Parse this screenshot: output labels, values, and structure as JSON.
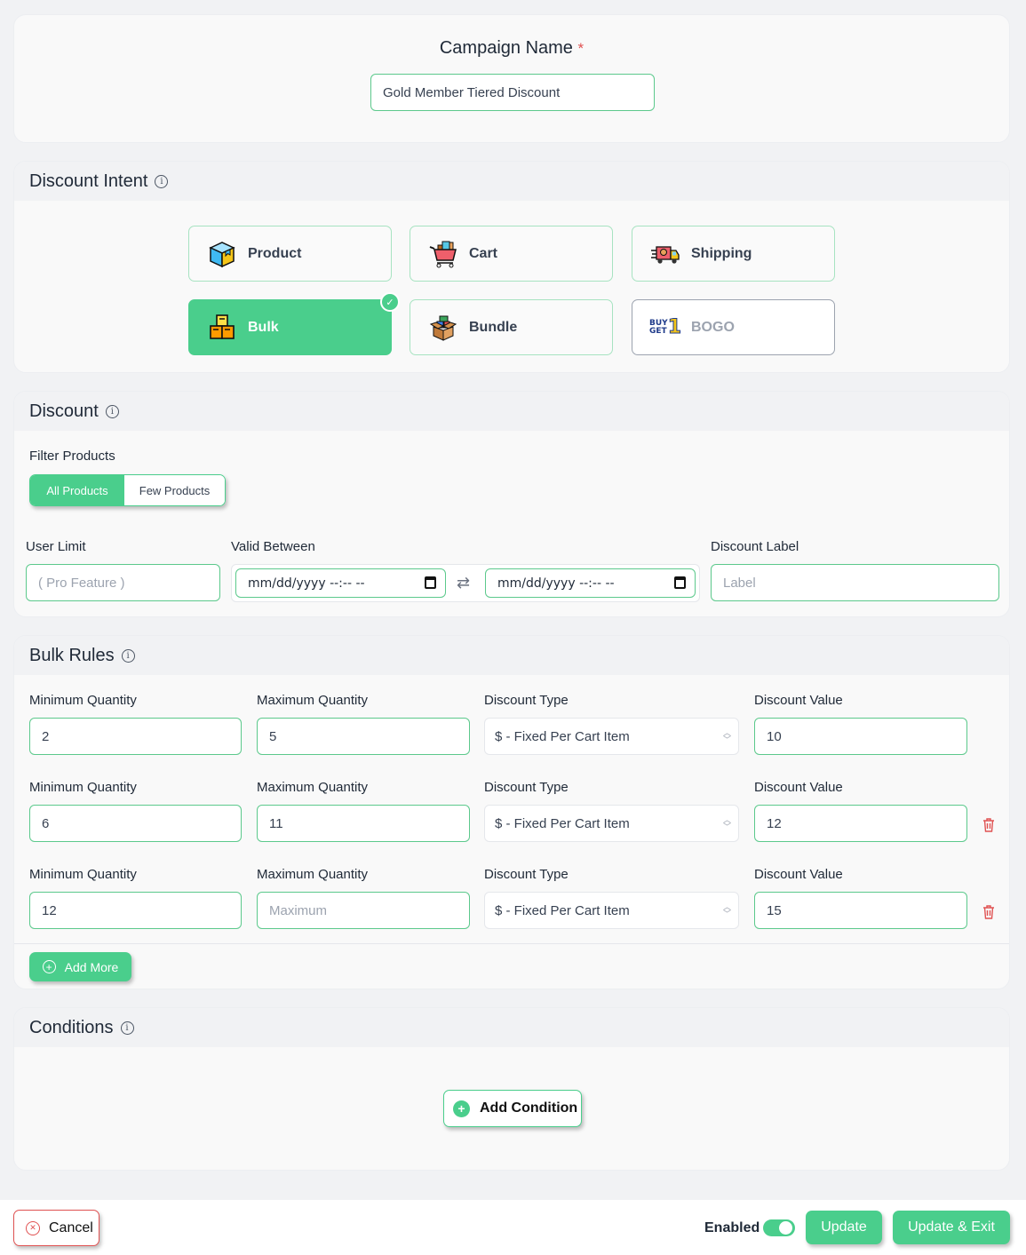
{
  "campaign": {
    "label": "Campaign Name",
    "required_mark": "*",
    "value": "Gold Member Tiered Discount"
  },
  "intent": {
    "title": "Discount Intent",
    "info_icon": "info-icon",
    "options": [
      {
        "label": "Product",
        "icon": "product-box-icon",
        "state": "default"
      },
      {
        "label": "Cart",
        "icon": "shopping-cart-icon",
        "state": "default"
      },
      {
        "label": "Shipping",
        "icon": "delivery-truck-icon",
        "state": "default"
      },
      {
        "label": "Bulk",
        "icon": "stacked-boxes-icon",
        "state": "selected"
      },
      {
        "label": "Bundle",
        "icon": "open-box-icon",
        "state": "default"
      },
      {
        "label": "BOGO",
        "icon": "buy-get-one-icon",
        "state": "disabled"
      }
    ],
    "bogo_icon_text": [
      "BUY",
      "GET",
      "1"
    ]
  },
  "discount": {
    "title": "Discount",
    "filter_label": "Filter Products",
    "filter_options": [
      "All Products",
      "Few Products"
    ],
    "filter_selected": "All Products",
    "user_limit_label": "User Limit",
    "user_limit_placeholder": "( Pro Feature )",
    "valid_between_label": "Valid Between",
    "date_start_placeholder": "mm/dd/yyyy --:-- --",
    "date_end_placeholder": "mm/dd/yyyy --:-- --",
    "swap_icon": "⇄",
    "label_label": "Discount Label",
    "label_placeholder": "Label"
  },
  "bulk_rules": {
    "title": "Bulk Rules",
    "headers": {
      "min": "Minimum Quantity",
      "max": "Maximum Quantity",
      "type": "Discount Type",
      "value": "Discount Value"
    },
    "max_placeholder": "Maximum",
    "rows": [
      {
        "min": "2",
        "max": "5",
        "type": "$ - Fixed Per Cart Item",
        "value": "10",
        "deletable": false
      },
      {
        "min": "6",
        "max": "11",
        "type": "$ - Fixed Per Cart Item",
        "value": "12",
        "deletable": true
      },
      {
        "min": "12",
        "max": "",
        "type": "$ - Fixed Per Cart Item",
        "value": "15",
        "deletable": true
      }
    ],
    "add_more_label": "Add More"
  },
  "conditions": {
    "title": "Conditions",
    "add_label": "Add Condition"
  },
  "footer": {
    "cancel_label": "Cancel",
    "enabled_label": "Enabled",
    "enabled": true,
    "update_label": "Update",
    "update_exit_label": "Update & Exit"
  },
  "colors": {
    "accent": "#4ace8c",
    "danger": "#e05252"
  }
}
